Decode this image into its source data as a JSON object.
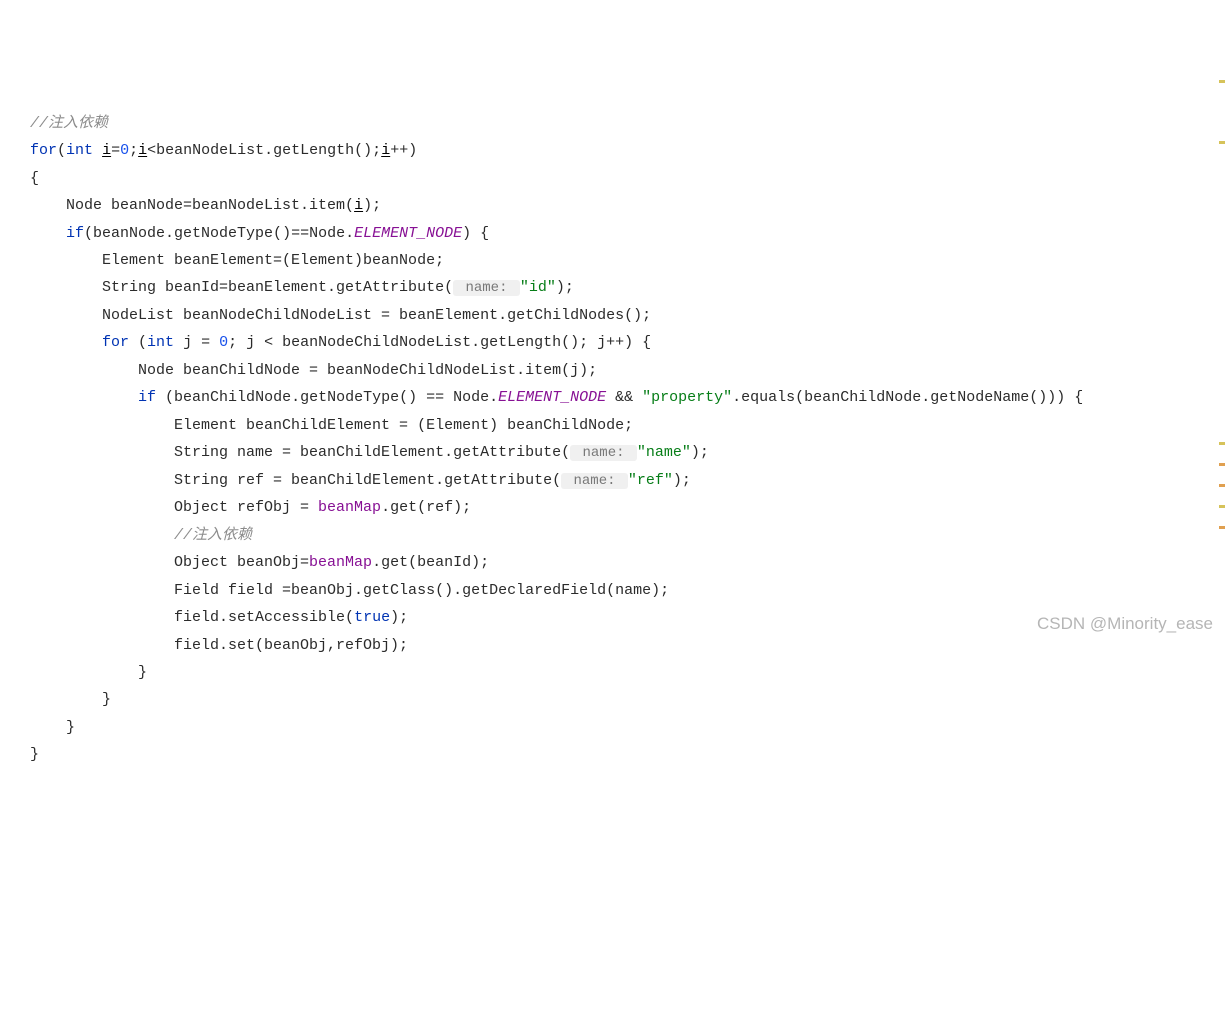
{
  "code": {
    "c0": "//注入依赖",
    "l1_for": "for",
    "l1_int": "int",
    "l1_i": "i",
    "l1_eq": "=",
    "l1_zero": "0",
    "l1_semi": ";",
    "l1_i2": "i",
    "l1_rest": "<beanNodeList.getLength();",
    "l1_i3": "i",
    "l1_pp_close": "++)",
    "l2_brace": "{",
    "l3_a": "    Node beanNode=beanNodeList.item(",
    "l3_i": "i",
    "l3_b": ");",
    "l4_if": "if",
    "l4_mid": "(beanNode.getNodeType()==Node.",
    "l4_elem": "ELEMENT_NODE",
    "l4_end": ") {",
    "l5": "        Element beanElement=(Element)beanNode;",
    "l6_a": "        String beanId=beanElement.getAttribute(",
    "l6_hint": " name: ",
    "l6_str": "\"id\"",
    "l6_end": ");",
    "l7": "        NodeList beanNodeChildNodeList = beanElement.getChildNodes();",
    "l8_for": "for",
    "l8_open": " (",
    "l8_int": "int",
    "l8_j": " j = ",
    "l8_zero": "0",
    "l8_rest": "; j < beanNodeChildNodeList.getLength(); j++) {",
    "l9": "            Node beanChildNode = beanNodeChildNodeList.item(j);",
    "l10_if": "if",
    "l10_a": " (beanChildNode.getNodeType() == Node.",
    "l10_elem": "ELEMENT_NODE",
    "l10_and": " && ",
    "l10_str": "\"property\"",
    "l10_b": ".equals(beanChildNode.getNodeName())) {",
    "l11": "                Element beanChildElement = (Element) beanChildNode;",
    "l12_a": "                String name = beanChildElement.getAttribute(",
    "l12_hint": " name: ",
    "l12_str": "\"name\"",
    "l12_end": ");",
    "l13_a": "                String ref = beanChildElement.getAttribute(",
    "l13_hint": " name: ",
    "l13_str": "\"ref\"",
    "l13_end": ");",
    "l14_a": "                Object refObj = ",
    "l14_field": "beanMap",
    "l14_b": ".get(ref);",
    "c15": "                //注入依赖",
    "l16_a": "                Object beanObj=",
    "l16_field": "beanMap",
    "l16_b": ".get(beanId);",
    "l17": "                Field field =beanObj.getClass().getDeclaredField(name);",
    "l18_a": "                field.setAccessible(",
    "l18_true": "true",
    "l18_b": ");",
    "l19": "                field.set(beanObj,refObj);",
    "l20": "            }",
    "l21": "        }",
    "l22": "    }",
    "l23": "}"
  },
  "watermark": "CSDN @Minority_ease"
}
